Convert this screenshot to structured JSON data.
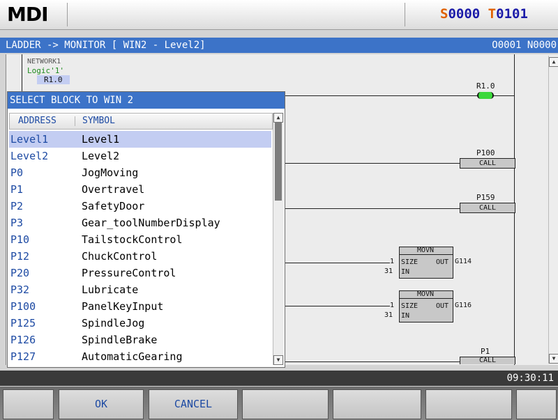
{
  "header": {
    "mode": "MDI",
    "spindle_prefix": "S",
    "spindle_value": "0000",
    "tool_prefix": "T",
    "tool_value": "0101"
  },
  "title_bar": {
    "path": "LADDER -> MONITOR [ WIN2 - Level2]",
    "program": "O0001 N0000"
  },
  "ladder": {
    "network_label": "NETWORK1",
    "logic_label": "Logic'1'",
    "contact_label": "R1.0",
    "coil_label": "R1.0",
    "call1_label": "P100",
    "call1_box": "CALL",
    "call2_label": "P159",
    "call2_box": "CALL",
    "movn1": {
      "name": "MOVN",
      "size_pin": "SIZE",
      "out_pin": "OUT",
      "in_pin": "IN",
      "size_val": "1",
      "in_val": "31",
      "out_val": "G114"
    },
    "movn2": {
      "name": "MOVN",
      "size_pin": "SIZE",
      "out_pin": "OUT",
      "in_pin": "IN",
      "size_val": "1",
      "in_val": "31",
      "out_val": "G116"
    },
    "call3_label": "P1",
    "call3_box": "CALL"
  },
  "dialog": {
    "title": "SELECT BLOCK TO WIN 2",
    "col_address": "ADDRESS",
    "col_symbol": "SYMBOL",
    "rows": [
      {
        "address": "Level1",
        "symbol": "Level1"
      },
      {
        "address": "Level2",
        "symbol": "Level2"
      },
      {
        "address": "P0",
        "symbol": "JogMoving"
      },
      {
        "address": "P1",
        "symbol": "Overtravel"
      },
      {
        "address": "P2",
        "symbol": "SafetyDoor"
      },
      {
        "address": "P3",
        "symbol": "Gear_toolNumberDisplay"
      },
      {
        "address": "P10",
        "symbol": "TailstockControl"
      },
      {
        "address": "P12",
        "symbol": "ChuckControl"
      },
      {
        "address": "P20",
        "symbol": "PressureControl"
      },
      {
        "address": "P32",
        "symbol": "Lubricate"
      },
      {
        "address": "P100",
        "symbol": "PanelKeyInput"
      },
      {
        "address": "P125",
        "symbol": "SpindleJog"
      },
      {
        "address": "P126",
        "symbol": "SpindleBrake"
      },
      {
        "address": "P127",
        "symbol": "AutomaticGearing"
      }
    ],
    "selected_index": 0
  },
  "status": {
    "time": "09:30:11"
  },
  "softkeys": [
    "",
    "OK",
    "CANCEL",
    "",
    "",
    "",
    ""
  ]
}
